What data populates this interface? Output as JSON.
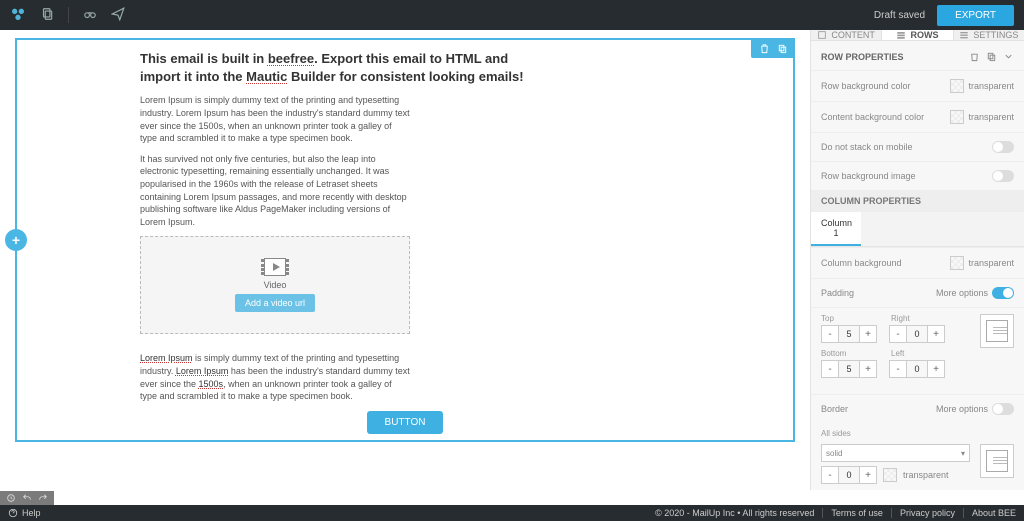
{
  "topbar": {
    "draft_status": "Draft saved",
    "export_label": "EXPORT"
  },
  "canvas": {
    "heading_prefix": "This email is built in ",
    "heading_link1": "beefree",
    "heading_mid": ". Export this email to HTML and import it into the ",
    "heading_link2": "Mautic",
    "heading_suffix": " Builder for consistent looking emails!",
    "para1": "Lorem Ipsum is simply dummy text of the printing and typesetting industry. Lorem Ipsum has been the industry's standard dummy text ever since the 1500s, when an unknown printer took a galley of type and scrambled it to make a type specimen book.",
    "para2": "It has survived not only five centuries, but also the leap into electronic typesetting, remaining essentially unchanged. It was popularised in the 1960s with the release of Letraset sheets containing Lorem Ipsum passages, and more recently with desktop publishing software like Aldus PageMaker including versions of Lorem Ipsum.",
    "video_label": "Video",
    "video_btn": "Add a video url",
    "para3_a": "Lorem Ipsum",
    "para3_b": " is simply dummy text of the printing and typesetting industry. ",
    "para3_c": "Lorem Ipsum",
    "para3_d": " has been the industry's standard dummy text ever since the ",
    "para3_e": "1500s",
    "para3_f": ", when an unknown printer took a galley of type and scrambled it to make a type specimen book.",
    "button_label": "BUTTON"
  },
  "panel": {
    "tab_content": "CONTENT",
    "tab_rows": "ROWS",
    "tab_settings": "SETTINGS",
    "row_properties": "ROW PROPERTIES",
    "row_bg_color": "Row background color",
    "content_bg_color": "Content background color",
    "do_not_stack": "Do not stack on mobile",
    "row_bg_image": "Row background image",
    "transparent": "transparent",
    "column_properties": "COLUMN PROPERTIES",
    "column1": "Column 1",
    "column_bg": "Column background",
    "padding": "Padding",
    "more_options": "More options",
    "top": "Top",
    "right": "Right",
    "bottom": "Bottom",
    "left": "Left",
    "pad_top": "5",
    "pad_right": "0",
    "pad_bottom": "5",
    "pad_left": "0",
    "border": "Border",
    "all_sides": "All sides",
    "border_style": "solid",
    "border_width": "0"
  },
  "footer": {
    "help": "Help",
    "copyright": "© 2020 - MailUp Inc • All rights reserved",
    "terms": "Terms of use",
    "privacy": "Privacy policy",
    "about": "About BEE"
  }
}
